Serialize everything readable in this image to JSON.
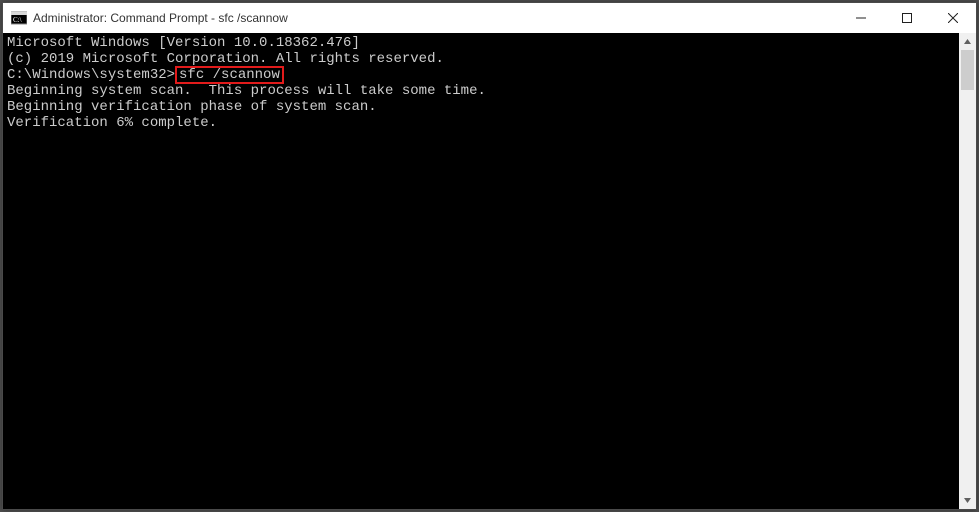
{
  "window": {
    "title": "Administrator: Command Prompt - sfc  /scannow"
  },
  "terminal": {
    "line1": "Microsoft Windows [Version 10.0.18362.476]",
    "line2": "(c) 2019 Microsoft Corporation. All rights reserved.",
    "blank1": "",
    "prompt": "C:\\Windows\\system32>",
    "command": "sfc /scannow",
    "blank2": "",
    "line3": "Beginning system scan.  This process will take some time.",
    "blank3": "",
    "line4": "Beginning verification phase of system scan.",
    "line5": "Verification 6% complete."
  }
}
